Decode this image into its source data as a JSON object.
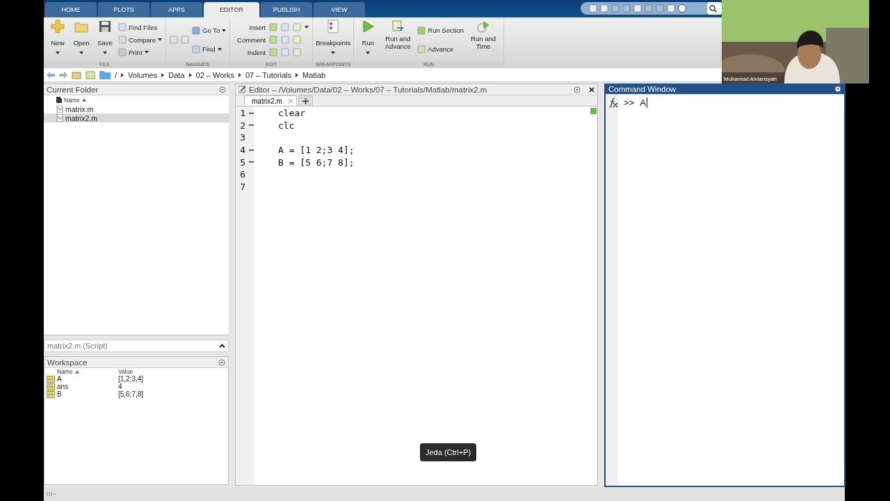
{
  "tabs": [
    {
      "label": "HOME",
      "selected": false
    },
    {
      "label": "PLOTS",
      "selected": false
    },
    {
      "label": "APPS",
      "selected": false
    },
    {
      "label": "EDITOR",
      "selected": true
    },
    {
      "label": "PUBLISH",
      "selected": false
    },
    {
      "label": "VIEW",
      "selected": false
    }
  ],
  "ribbon": [
    {
      "label": "FILE",
      "items": [
        {
          "kind": "large",
          "label": "New",
          "dropdown": true
        },
        {
          "kind": "large",
          "label": "Open",
          "dropdown": true
        },
        {
          "kind": "large",
          "label": "Save",
          "dropdown": true
        },
        {
          "kind": "stack",
          "rows": [
            {
              "label": "Find Files",
              "dropdown": false
            },
            {
              "label": "Compare",
              "dropdown": true
            },
            {
              "label": "Print",
              "dropdown": true
            }
          ]
        }
      ]
    },
    {
      "label": "NAVIGATE",
      "items": [
        {
          "kind": "stack",
          "rows": [
            {
              "label": "Go To",
              "dropdown": true
            },
            {
              "label": "Find",
              "dropdown": true
            }
          ]
        }
      ]
    },
    {
      "label": "EDIT",
      "items": [
        {
          "kind": "grid",
          "rows": [
            {
              "label": "Insert",
              "dropdown": true
            },
            {
              "label": "Comment",
              "dropdown": false
            },
            {
              "label": "Indent",
              "dropdown": false
            }
          ]
        }
      ]
    },
    {
      "label": "BREAKPOINTS",
      "items": [
        {
          "kind": "large",
          "label": "Breakpoints",
          "dropdown": true
        }
      ]
    },
    {
      "label": "RUN",
      "items": [
        {
          "kind": "large",
          "label": "Run",
          "dropdown": true
        },
        {
          "kind": "large",
          "label": "Run and Advance",
          "dropdown": false
        },
        {
          "kind": "stack",
          "rows": [
            {
              "label": "Run Section",
              "dropdown": false
            },
            {
              "label": "Advance",
              "dropdown": false
            }
          ]
        },
        {
          "kind": "large",
          "label": "Run and Time",
          "dropdown": false
        }
      ]
    }
  ],
  "breadcrumb": [
    "/",
    "Volumes",
    "Data",
    "02 – Works",
    "07 – Tutorials",
    "Matlab"
  ],
  "current_folder": {
    "title": "Current Folder",
    "column": "Name",
    "files": [
      {
        "name": "matrix.m",
        "selected": false
      },
      {
        "name": "matrix2.m",
        "selected": true
      }
    ],
    "details": "matrix2.m  (Script)"
  },
  "workspace": {
    "title": "Workspace",
    "columns": [
      "Name",
      "Value"
    ],
    "rows": [
      {
        "name": "A",
        "value": "[1,2;3,4]"
      },
      {
        "name": "ans",
        "value": "4"
      },
      {
        "name": "B",
        "value": "[5,6;7,8]"
      }
    ]
  },
  "editor": {
    "title": "Editor – /Volumes/Data/02 – Works/07 – Tutorials/Matlab/matrix2.m",
    "tabs": [
      {
        "label": "matrix2.m",
        "selected": true
      }
    ],
    "lines": [
      {
        "number": "1",
        "code": "clear",
        "executable": true
      },
      {
        "number": "2",
        "code": "clc",
        "executable": true
      },
      {
        "number": "3",
        "executable": false
      },
      {
        "number": "4",
        "code": "A = [1 2;3 4];",
        "executable": true
      },
      {
        "number": "5",
        "code": "B = [5 6;7 8];",
        "executable": true
      },
      {
        "number": "6",
        "executable": false
      },
      {
        "number": "7",
        "executable": false
      }
    ]
  },
  "command_window": {
    "title": "Command Window",
    "prompt": ">>",
    "input": "A"
  },
  "tooltip": "Jeda (Ctrl+P)",
  "webcam": {
    "kind": "picture",
    "name": "Muhamad Alviansyah"
  }
}
